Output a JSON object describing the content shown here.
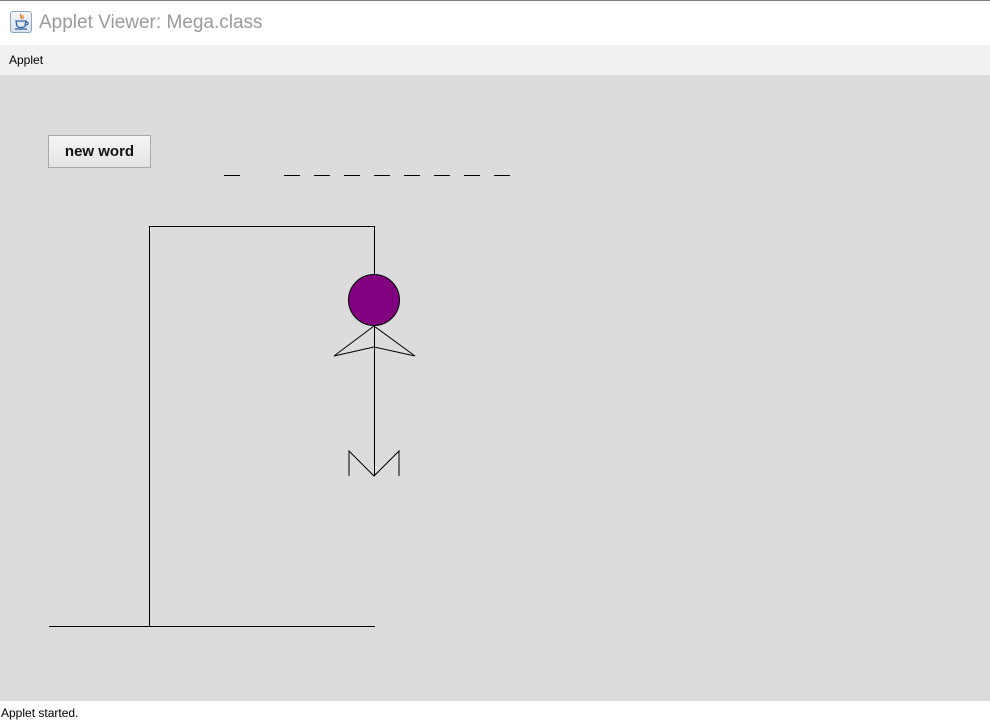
{
  "window": {
    "title": "Applet Viewer: Mega.class",
    "icon": "java-cup-icon"
  },
  "menubar": {
    "items": [
      {
        "label": "Applet"
      }
    ]
  },
  "applet": {
    "new_word_button": {
      "label": "new word"
    },
    "word": {
      "slots": [
        {
          "letter": "",
          "blank": true
        },
        {
          "letter": "",
          "blank": false
        },
        {
          "letter": "",
          "blank": true
        },
        {
          "letter": "",
          "blank": true
        },
        {
          "letter": "",
          "blank": true
        },
        {
          "letter": "",
          "blank": true
        },
        {
          "letter": "",
          "blank": true
        },
        {
          "letter": "",
          "blank": true
        },
        {
          "letter": "",
          "blank": true
        },
        {
          "letter": "",
          "blank": true
        }
      ]
    },
    "hangman": {
      "parts_shown": [
        "gallows",
        "rope",
        "head",
        "arms",
        "body",
        "legs"
      ],
      "head_color": "#800080"
    }
  },
  "statusbar": {
    "text": "Applet started."
  }
}
